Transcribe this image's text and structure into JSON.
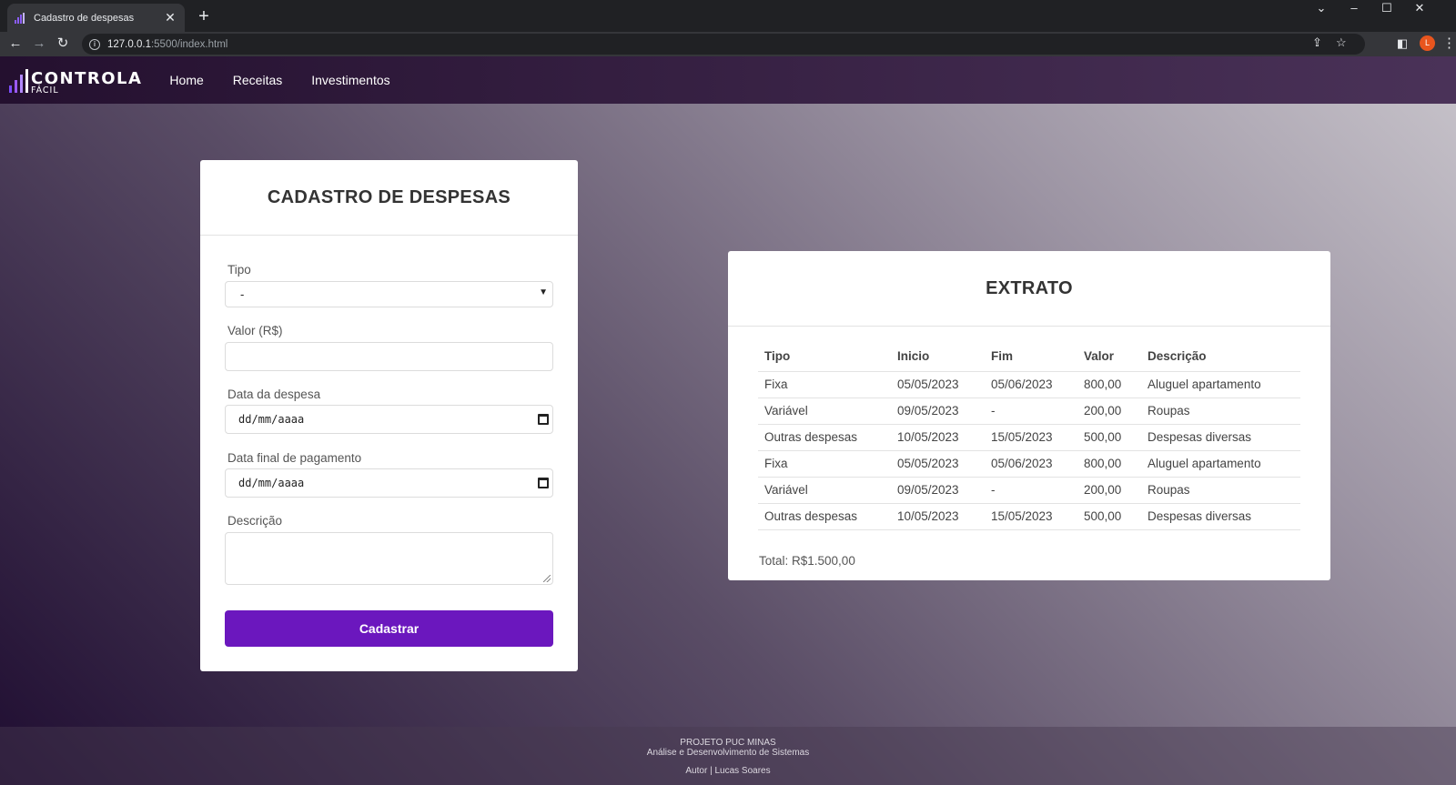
{
  "browser": {
    "tab_title": "Cadastro de despesas",
    "url_host": "127.0.0.1",
    "url_rest": ":5500/index.html",
    "profile_initial": "L"
  },
  "navbar": {
    "logo_main": "CONTROLA",
    "logo_sub": "FÁCIL",
    "links": [
      "Home",
      "Receitas",
      "Investimentos"
    ]
  },
  "form": {
    "title": "CADASTRO DE DESPESAS",
    "tipo_label": "Tipo",
    "tipo_value": "-",
    "valor_label": "Valor (R$)",
    "data_despesa_label": "Data da despesa",
    "data_despesa_placeholder": "dd/mm/aaaa",
    "data_final_label": "Data final de pagamento",
    "data_final_placeholder": "dd/mm/aaaa",
    "descricao_label": "Descrição",
    "submit_label": "Cadastrar"
  },
  "extrato": {
    "title": "EXTRATO",
    "columns": [
      "Tipo",
      "Inicio",
      "Fim",
      "Valor",
      "Descrição"
    ],
    "rows": [
      [
        "Fixa",
        "05/05/2023",
        "05/06/2023",
        "800,00",
        "Aluguel apartamento"
      ],
      [
        "Variável",
        "09/05/2023",
        "-",
        "200,00",
        "Roupas"
      ],
      [
        "Outras despesas",
        "10/05/2023",
        "15/05/2023",
        "500,00",
        "Despesas diversas"
      ],
      [
        "Fixa",
        "05/05/2023",
        "05/06/2023",
        "800,00",
        "Aluguel apartamento"
      ],
      [
        "Variável",
        "09/05/2023",
        "-",
        "200,00",
        "Roupas"
      ],
      [
        "Outras despesas",
        "10/05/2023",
        "15/05/2023",
        "500,00",
        "Despesas diversas"
      ]
    ],
    "total": "Total: R$1.500,00"
  },
  "footer": {
    "line1": "PROJETO PUC MINAS",
    "line2": "Análise e Desenvolvimento de Sistemas",
    "line3": "Autor | Lucas Soares"
  },
  "colors": {
    "accent": "#6b17be",
    "logo_bar_colors": [
      "#7c4dff",
      "#9b59f5",
      "#b388ff",
      "#ffffff"
    ]
  },
  "icons": {
    "back": "arrow-left",
    "forward": "arrow-right",
    "reload": "reload",
    "bookmark": "star",
    "share": "share",
    "side_panel": "side-panel",
    "menu": "kebab-menu"
  }
}
